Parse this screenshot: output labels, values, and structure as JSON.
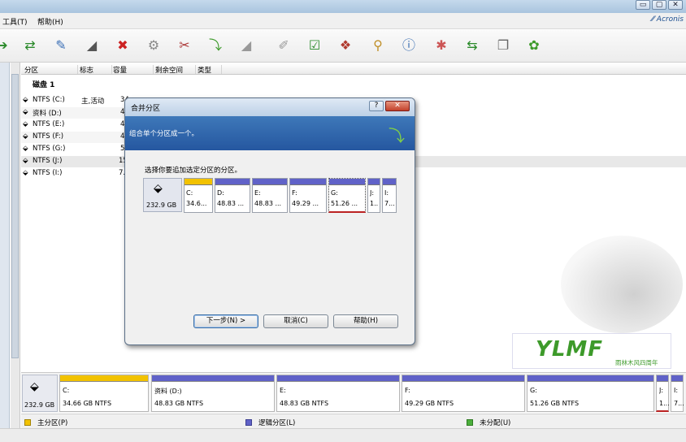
{
  "window": {
    "minimize_label": "▭",
    "maximize_label": "▢",
    "close_label": "✕"
  },
  "menubar": {
    "tools_label": "工具(T)",
    "help_label": "帮助(H)",
    "brand": "Acronis"
  },
  "toolbar": {
    "icons": [
      "arrow-right-icon",
      "swap-arrows-icon",
      "disk-check-icon",
      "disk-edit-icon",
      "disk-delete-icon",
      "disk-settings-icon",
      "disk-tool-icon",
      "disk-green-arrow-icon",
      "disk-gray-icon",
      "brush-icon",
      "checklist-icon",
      "package-icon",
      "search-icon",
      "info-icon",
      "partition-new-icon",
      "partition-move-icon",
      "partition-copy-icon",
      "settings-gear-icon"
    ]
  },
  "list": {
    "headers": [
      "分区",
      "标志",
      "容量",
      "剩余空间",
      "类型"
    ],
    "disk_group": "磁盘 1",
    "rows": [
      {
        "name": "NTFS (C:)",
        "flag": "主,活动",
        "capacity": "34"
      },
      {
        "name": "资料 (D:)",
        "flag": "",
        "capacity": "4"
      },
      {
        "name": "NTFS (E:)",
        "flag": "",
        "capacity": "4"
      },
      {
        "name": "NTFS (F:)",
        "flag": "",
        "capacity": "4"
      },
      {
        "name": "NTFS (G:)",
        "flag": "",
        "capacity": "5"
      },
      {
        "name": "NTFS (J:)",
        "flag": "",
        "capacity": "15"
      },
      {
        "name": "NTFS (I:)",
        "flag": "",
        "capacity": "7."
      }
    ]
  },
  "dialog": {
    "title": "合并分区",
    "help_button": "?",
    "close_button": "✕",
    "header_text": "组合单个分区成一个。",
    "prompt": "选择你要追加选定分区的分区。",
    "disk_size": "232.9 GB",
    "partitions": [
      {
        "label": "C:",
        "size": "34.6..."
      },
      {
        "label": "D:",
        "size": "48.83 ..."
      },
      {
        "label": "E:",
        "size": "48.83 ..."
      },
      {
        "label": "F:",
        "size": "49.29 ..."
      },
      {
        "label": "G:",
        "size": "51.26 ..."
      },
      {
        "label": "J:",
        "size": "1..."
      },
      {
        "label": "I:",
        "size": "7..."
      }
    ],
    "next_button": "下一步(N) >",
    "cancel_button": "取消(C)",
    "help_text_button": "帮助(H)"
  },
  "disk_map": {
    "disk_size": "232.9 GB",
    "partitions": [
      {
        "label": "C:",
        "size": "34.66 GB  NTFS"
      },
      {
        "label": "资料 (D:)",
        "size": "48.83 GB  NTFS"
      },
      {
        "label": "E:",
        "size": "48.83 GB  NTFS"
      },
      {
        "label": "F:",
        "size": "49.29 GB  NTFS"
      },
      {
        "label": "G:",
        "size": "51.26 GB  NTFS"
      },
      {
        "label": "J:",
        "size": "1..."
      },
      {
        "label": "I:",
        "size": "7..."
      }
    ]
  },
  "legend": {
    "primary": "主分区(P)",
    "logical": "逻辑分区(L)",
    "unallocated": "未分配(U)"
  },
  "watermark": {
    "logo": "YLMF",
    "subtitle": "雨林木风四周年"
  },
  "colors": {
    "primary": "#f2c200",
    "logical": "#6062c8",
    "unallocated": "#4caf3c",
    "header_blue": "#2f66ad"
  }
}
